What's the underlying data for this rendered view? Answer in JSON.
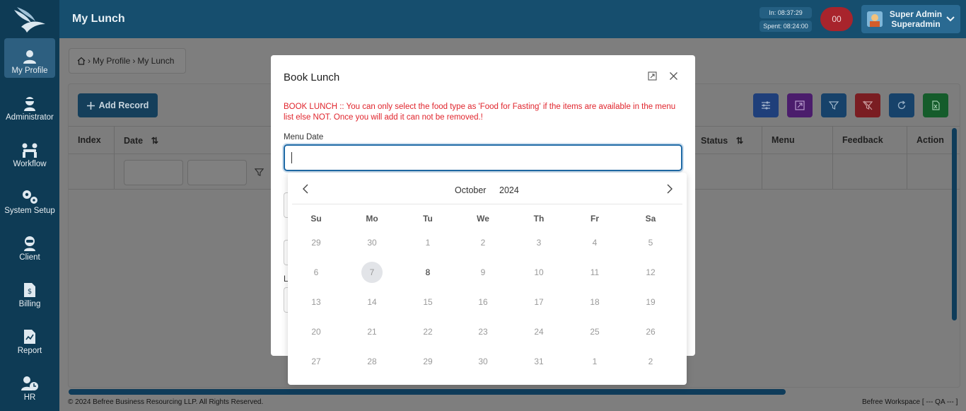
{
  "header": {
    "page_title": "My Lunch",
    "time_in": "In: 08:37:29",
    "time_spent": "Spent: 08:24:00",
    "notification_count": "00",
    "user_line1": "Super Admin",
    "user_line2": "Superadmin"
  },
  "sidebar": {
    "items": [
      {
        "label": "My Profile",
        "icon": "user-icon"
      },
      {
        "label": "Administrator",
        "icon": "admin-icon"
      },
      {
        "label": "Workflow",
        "icon": "workflow-icon"
      },
      {
        "label": "System Setup",
        "icon": "gears-icon"
      },
      {
        "label": "Client",
        "icon": "client-icon"
      },
      {
        "label": "Billing",
        "icon": "billing-icon"
      },
      {
        "label": "Report",
        "icon": "report-icon"
      },
      {
        "label": "HR",
        "icon": "hr-icon"
      }
    ]
  },
  "breadcrumb": {
    "home_icon": "home-icon",
    "item1": "My Profile",
    "item2": "My Lunch"
  },
  "toolbar": {
    "add_label": "Add Record"
  },
  "table": {
    "headers": {
      "index": "Index",
      "date": "Date",
      "status": "Status",
      "menu": "Menu",
      "feedback": "Feedback",
      "action": "Action"
    }
  },
  "footer": {
    "copyright": "© 2024 Befree Business Resourcing LLP. All Rights Reserved.",
    "workspace": "Befree Workspace [ --- QA --- ]"
  },
  "modal": {
    "title": "Book Lunch",
    "notice": "BOOK LUNCH :: You can only select the food type as 'Food for Fasting' if the items are available in the menu list else NOT. Once you will add it can not be removed.!",
    "menu_date_label": "Menu Date",
    "partial_label": "L"
  },
  "calendar": {
    "month": "October",
    "year": "2024",
    "weekdays": [
      "Su",
      "Mo",
      "Tu",
      "We",
      "Th",
      "Fr",
      "Sa"
    ],
    "weeks": [
      [
        "29",
        "30",
        "1",
        "2",
        "3",
        "4",
        "5"
      ],
      [
        "6",
        "7",
        "8",
        "9",
        "10",
        "11",
        "12"
      ],
      [
        "13",
        "14",
        "15",
        "16",
        "17",
        "18",
        "19"
      ],
      [
        "20",
        "21",
        "22",
        "23",
        "24",
        "25",
        "26"
      ],
      [
        "27",
        "28",
        "29",
        "30",
        "31",
        "1",
        "2"
      ]
    ],
    "today": "7",
    "first_selectable": "8"
  },
  "colors": {
    "sidebar_bg": "#0e3b55",
    "header_bg": "#164e6e",
    "accent_blue": "#1f6aa6",
    "notice_red": "#e0242c"
  }
}
